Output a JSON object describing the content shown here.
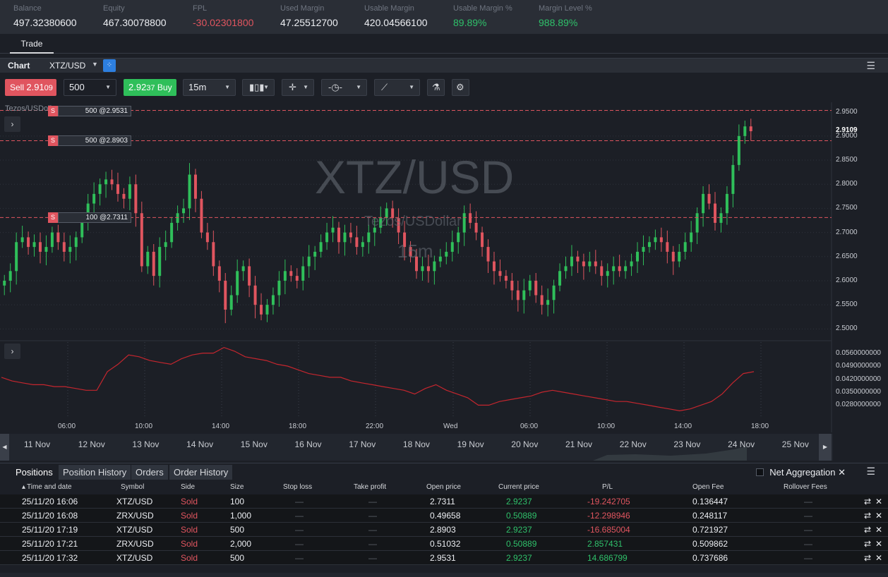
{
  "summary": [
    {
      "label": "Balance",
      "value": "497.32380600",
      "tone": ""
    },
    {
      "label": "Equity",
      "value": "467.30078800",
      "tone": ""
    },
    {
      "label": "FPL",
      "value": "-30.02301800",
      "tone": "neg"
    },
    {
      "label": "Used Margin",
      "value": "47.25512700",
      "tone": ""
    },
    {
      "label": "Usable Margin",
      "value": "420.04566100",
      "tone": ""
    },
    {
      "label": "Usable Margin %",
      "value": "89.89%",
      "tone": "pos"
    },
    {
      "label": "Margin Level %",
      "value": "988.89%",
      "tone": "pos"
    }
  ],
  "tabs": {
    "trade": "Trade"
  },
  "chart_header": {
    "title": "Chart",
    "symbol": "XTZ/USD"
  },
  "toolbar": {
    "sell_label": "Sell",
    "sell_price_main": "2.91",
    "sell_price_tail": "09",
    "quantity": "500",
    "buy_price_main": "2.92",
    "buy_price_tail": "37",
    "buy_label": "Buy",
    "timeframe": "15m"
  },
  "chart_text": {
    "pair_label": "Tezos/USDollar",
    "watermark_symbol": "XTZ/USD",
    "watermark_name": "Tezos/USDollar",
    "watermark_tf": "15m",
    "current_price": "2.9109"
  },
  "order_tags": [
    {
      "side": "S",
      "label": "500 @2.9531",
      "price": 2.9531
    },
    {
      "side": "S",
      "label": "500 @2.8903",
      "price": 2.8903
    },
    {
      "side": "S",
      "label": "100 @2.7311",
      "price": 2.7311
    }
  ],
  "colors": {
    "up": "#2fbf5a",
    "down": "#e0555f",
    "indicator": "#c4262e",
    "order_line": "#e0555f"
  },
  "chart_data": {
    "type": "candlestick",
    "ylim": [
      2.48,
      2.97
    ],
    "price_ticks": [
      "2.9500",
      "2.9000",
      "2.8500",
      "2.8000",
      "2.7500",
      "2.7000",
      "2.6500",
      "2.6000",
      "2.5500",
      "2.5000"
    ],
    "time_ticks": [
      "06:00",
      "10:00",
      "14:00",
      "18:00",
      "22:00",
      "Wed",
      "06:00",
      "10:00",
      "14:00",
      "18:00"
    ],
    "indicator_ticks": [
      "0.0560000000",
      "0.0490000000",
      "0.0420000000",
      "0.0350000000",
      "0.0280000000"
    ],
    "indicator_ylim": [
      0.024,
      0.06
    ],
    "closes": [
      2.6,
      2.62,
      2.68,
      2.69,
      2.67,
      2.68,
      2.66,
      2.67,
      2.7,
      2.68,
      2.66,
      2.67,
      2.69,
      2.72,
      2.76,
      2.78,
      2.8,
      2.81,
      2.8,
      2.78,
      2.77,
      2.8,
      2.74,
      2.63,
      2.66,
      2.61,
      2.67,
      2.68,
      2.72,
      2.74,
      2.75,
      2.82,
      2.77,
      2.7,
      2.68,
      2.63,
      2.6,
      2.54,
      2.57,
      2.62,
      2.63,
      2.59,
      2.55,
      2.53,
      2.55,
      2.57,
      2.6,
      2.62,
      2.61,
      2.6,
      2.63,
      2.65,
      2.66,
      2.68,
      2.7,
      2.71,
      2.68,
      2.7,
      2.69,
      2.67,
      2.68,
      2.7,
      2.71,
      2.73,
      2.75,
      2.73,
      2.7,
      2.67,
      2.65,
      2.62,
      2.63,
      2.62,
      2.64,
      2.65,
      2.66,
      2.68,
      2.7,
      2.74,
      2.72,
      2.7,
      2.67,
      2.64,
      2.62,
      2.61,
      2.6,
      2.58,
      2.56,
      2.58,
      2.6,
      2.57,
      2.55,
      2.56,
      2.59,
      2.62,
      2.63,
      2.65,
      2.64,
      2.63,
      2.64,
      2.63,
      2.61,
      2.62,
      2.63,
      2.62,
      2.63,
      2.64,
      2.66,
      2.67,
      2.68,
      2.69,
      2.68,
      2.66,
      2.64,
      2.66,
      2.68,
      2.7,
      2.74,
      2.78,
      2.76,
      2.72,
      2.74,
      2.78,
      2.84,
      2.9,
      2.92,
      2.91
    ],
    "indicator": [
      0.043,
      0.041,
      0.04,
      0.039,
      0.039,
      0.038,
      0.038,
      0.037,
      0.036,
      0.036,
      0.046,
      0.05,
      0.055,
      0.054,
      0.052,
      0.051,
      0.05,
      0.053,
      0.055,
      0.056,
      0.056,
      0.059,
      0.057,
      0.054,
      0.053,
      0.052,
      0.05,
      0.049,
      0.047,
      0.045,
      0.044,
      0.043,
      0.043,
      0.041,
      0.04,
      0.039,
      0.038,
      0.037,
      0.036,
      0.034,
      0.037,
      0.039,
      0.036,
      0.034,
      0.032,
      0.028,
      0.028,
      0.03,
      0.031,
      0.032,
      0.033,
      0.035,
      0.036,
      0.035,
      0.034,
      0.033,
      0.032,
      0.031,
      0.03,
      0.03,
      0.029,
      0.028,
      0.027,
      0.026,
      0.025,
      0.026,
      0.028,
      0.03,
      0.034,
      0.04,
      0.045,
      0.046
    ]
  },
  "navigator": {
    "labels": [
      "11 Nov",
      "12 Nov",
      "13 Nov",
      "14 Nov",
      "15 Nov",
      "16 Nov",
      "17 Nov",
      "18 Nov",
      "19 Nov",
      "20 Nov",
      "21 Nov",
      "22 Nov",
      "23 Nov",
      "24 Nov",
      "25 Nov"
    ]
  },
  "positions_tabs": [
    "Positions",
    "Position History",
    "Orders",
    "Order History"
  ],
  "net_aggregation": "Net Aggregation",
  "columns": [
    "Time and date",
    "Symbol",
    "Side",
    "Size",
    "Stop loss",
    "Take profit",
    "Open price",
    "Current price",
    "P/L",
    "Open Fee",
    "Rollover Fees"
  ],
  "rows": [
    {
      "time": "25/11/20 16:06",
      "symbol": "XTZ/USD",
      "side": "Sold",
      "size": "100",
      "sl": "—",
      "tp": "—",
      "open": "2.7311",
      "current": "2.9237",
      "pl": "-19.242705",
      "pl_tone": "neg",
      "fee": "0.136447",
      "rollover": "—"
    },
    {
      "time": "25/11/20 16:08",
      "symbol": "ZRX/USD",
      "side": "Sold",
      "size": "1,000",
      "sl": "—",
      "tp": "—",
      "open": "0.49658",
      "current": "0.50889",
      "pl": "-12.298946",
      "pl_tone": "neg",
      "fee": "0.248117",
      "rollover": "—"
    },
    {
      "time": "25/11/20 17:19",
      "symbol": "XTZ/USD",
      "side": "Sold",
      "size": "500",
      "sl": "—",
      "tp": "—",
      "open": "2.8903",
      "current": "2.9237",
      "pl": "-16.685004",
      "pl_tone": "neg",
      "fee": "0.721927",
      "rollover": "—"
    },
    {
      "time": "25/11/20 17:21",
      "symbol": "ZRX/USD",
      "side": "Sold",
      "size": "2,000",
      "sl": "—",
      "tp": "—",
      "open": "0.51032",
      "current": "0.50889",
      "pl": "2.857431",
      "pl_tone": "pos",
      "fee": "0.509862",
      "rollover": "—"
    },
    {
      "time": "25/11/20 17:32",
      "symbol": "XTZ/USD",
      "side": "Sold",
      "size": "500",
      "sl": "—",
      "tp": "—",
      "open": "2.9531",
      "current": "2.9237",
      "pl": "14.686799",
      "pl_tone": "pos",
      "fee": "0.737686",
      "rollover": "—"
    }
  ],
  "icons": {
    "menu": "hamburger-icon",
    "link": "link-icon",
    "close": "close-icon",
    "reverse": "reverse-icon"
  }
}
